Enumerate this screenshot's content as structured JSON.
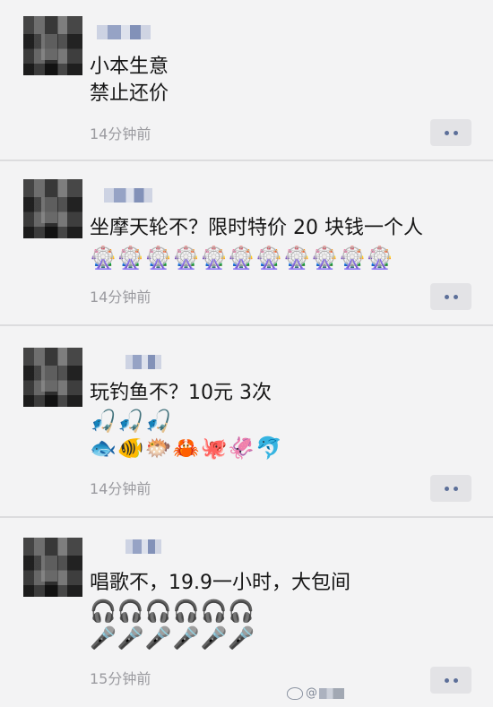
{
  "posts": [
    {
      "lines": [
        "小本生意",
        "禁止还价"
      ],
      "emoji_lines": [],
      "time": "14分钟前"
    },
    {
      "lines": [
        "坐摩天轮不？限时特价 20 块钱一个人"
      ],
      "emoji_lines": [
        "🎡🎡🎡🎡🎡🎡🎡🎡🎡🎡🎡"
      ],
      "time": "14分钟前"
    },
    {
      "lines": [
        "玩钓鱼不？10元 3次"
      ],
      "emoji_lines": [
        "🎣🎣🎣",
        "🐟🐠🐡🦀🐙🦑🐬"
      ],
      "time": "14分钟前"
    },
    {
      "lines": [
        "唱歌不，19.9一小时，大包间"
      ],
      "emoji_lines": [
        "🎧🎧🎧🎧🎧🎧",
        "🎤🎤🎤🎤🎤🎤"
      ],
      "time": "15分钟前"
    }
  ],
  "icons": {
    "more": "ellipsis-icon",
    "watermark_logo": "weibo-icon"
  },
  "watermark": {
    "prefix": "@"
  },
  "colors": {
    "background": "#f3f3f4",
    "divider": "#dcdcde",
    "time_text": "#9b9ba0",
    "more_dot": "#5c6f99"
  }
}
